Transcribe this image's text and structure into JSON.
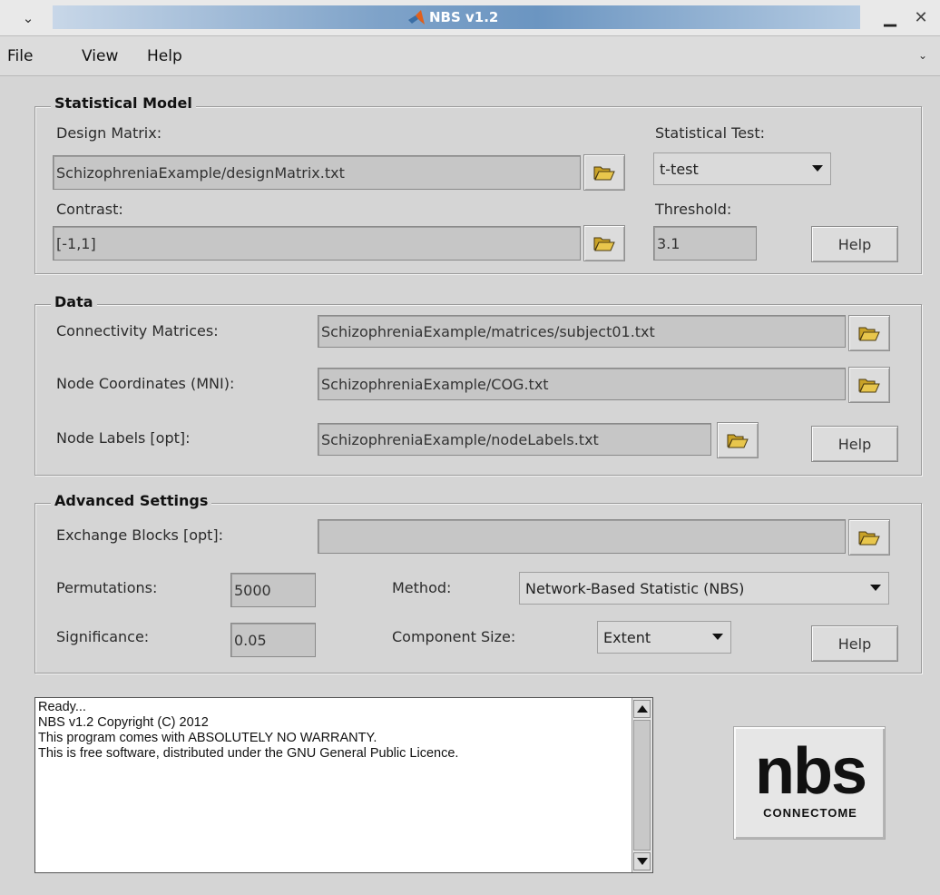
{
  "window": {
    "title": "NBS v1.2",
    "menu_glyph": "⌄",
    "minimize_glyph": "▁",
    "close_glyph": "✕"
  },
  "menu": {
    "file": "File",
    "view": "View",
    "help": "Help",
    "overflow_glyph": "⌄"
  },
  "statistical_model": {
    "title": "Statistical Model",
    "design_matrix_label": "Design Matrix:",
    "design_matrix_value": "SchizophreniaExample/designMatrix.txt",
    "contrast_label": "Contrast:",
    "contrast_value": "[-1,1]",
    "statistical_test_label": "Statistical Test:",
    "statistical_test_value": "t-test",
    "threshold_label": "Threshold:",
    "threshold_value": "3.1",
    "help_label": "Help"
  },
  "data": {
    "title": "Data",
    "connectivity_label": "Connectivity Matrices:",
    "connectivity_value": "SchizophreniaExample/matrices/subject01.txt",
    "node_coords_label": "Node Coordinates (MNI):",
    "node_coords_value": "SchizophreniaExample/COG.txt",
    "node_labels_label": "Node Labels [opt]:",
    "node_labels_value": "SchizophreniaExample/nodeLabels.txt",
    "help_label": "Help"
  },
  "advanced": {
    "title": "Advanced Settings",
    "exchange_label": "Exchange Blocks [opt]:",
    "exchange_value": "",
    "permutations_label": "Permutations:",
    "permutations_value": "5000",
    "significance_label": "Significance:",
    "significance_value": "0.05",
    "method_label": "Method:",
    "method_value": "Network-Based Statistic (NBS)",
    "component_size_label": "Component Size:",
    "component_size_value": "Extent",
    "help_label": "Help"
  },
  "console": {
    "lines": [
      "Ready...",
      "NBS v1.2 Copyright (C) 2012",
      "This program comes with ABSOLUTELY NO WARRANTY.",
      "This is free software, distributed under the GNU General Public Licence."
    ]
  },
  "logo": {
    "main": "nbs",
    "sub": "CONNECTOME"
  },
  "colors": {
    "titlebar_accent": "#6b95c1",
    "background": "#d5d5d5",
    "field": "#c6c6c6"
  },
  "icons": {
    "browse": "folder-open-icon",
    "app": "matlab-logo-icon"
  }
}
